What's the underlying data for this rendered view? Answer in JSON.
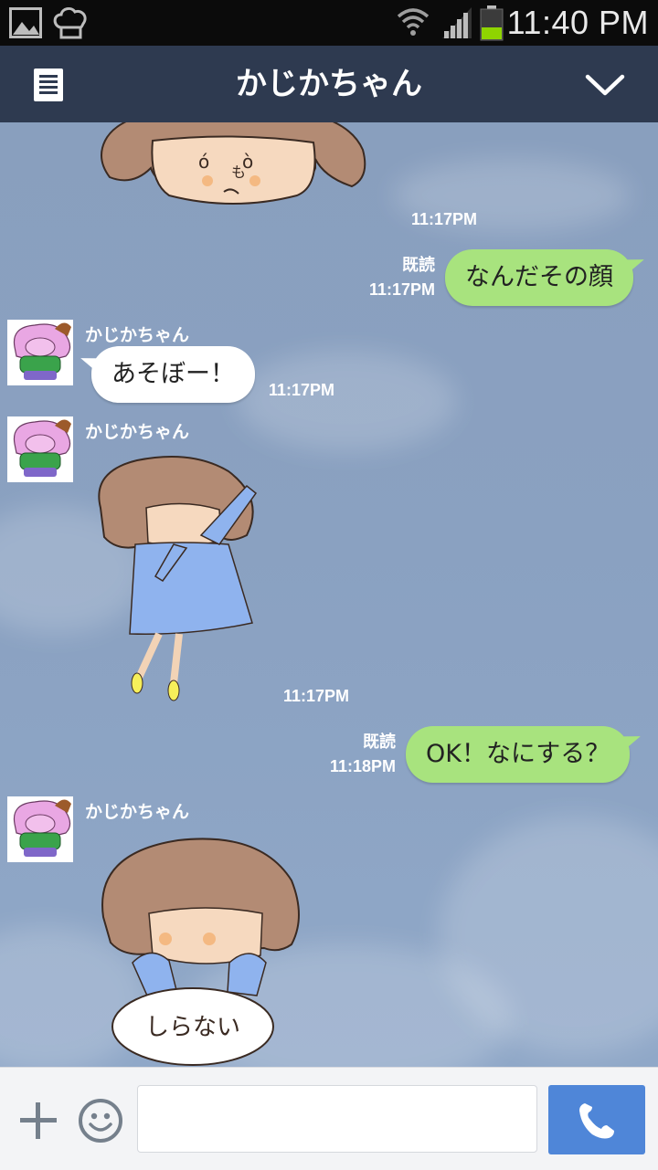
{
  "status_bar": {
    "time": "11:40 PM",
    "icons": [
      "gallery-icon",
      "chef-hat-icon",
      "wifi-icon",
      "signal-icon",
      "battery-icon"
    ]
  },
  "header": {
    "title": "かじかちゃん",
    "menu_icon": "list-menu-icon",
    "collapse_icon": "chevron-down-icon"
  },
  "messages": [
    {
      "type": "sticker",
      "direction": "in",
      "time": "11:17PM",
      "sticker": "sticker-pouting-girl"
    },
    {
      "type": "text",
      "direction": "out",
      "read": "既読",
      "time": "11:17PM",
      "text": "なんだその顔"
    },
    {
      "type": "text",
      "direction": "in",
      "sender": "かじかちゃん",
      "time": "11:17PM",
      "text": "あそぼー！"
    },
    {
      "type": "sticker",
      "direction": "in",
      "sender": "かじかちゃん",
      "time": "11:17PM",
      "sticker": "sticker-jumping-girl"
    },
    {
      "type": "text",
      "direction": "out",
      "read": "既読",
      "time": "11:18PM",
      "text": "OK！なにする？"
    },
    {
      "type": "sticker",
      "direction": "in",
      "sender": "かじかちゃん",
      "sticker": "sticker-shiranai-girl",
      "sticker_text": "しらない"
    }
  ],
  "footer": {
    "input_placeholder": "",
    "input_value": "",
    "plus_icon": "plus-icon",
    "emoji_icon": "smiley-icon",
    "call_icon": "phone-icon"
  },
  "colors": {
    "header_bg": "#2e3a50",
    "outgoing_bubble": "#a8e37e",
    "incoming_bubble": "#ffffff",
    "call_button": "#4f86d8"
  }
}
